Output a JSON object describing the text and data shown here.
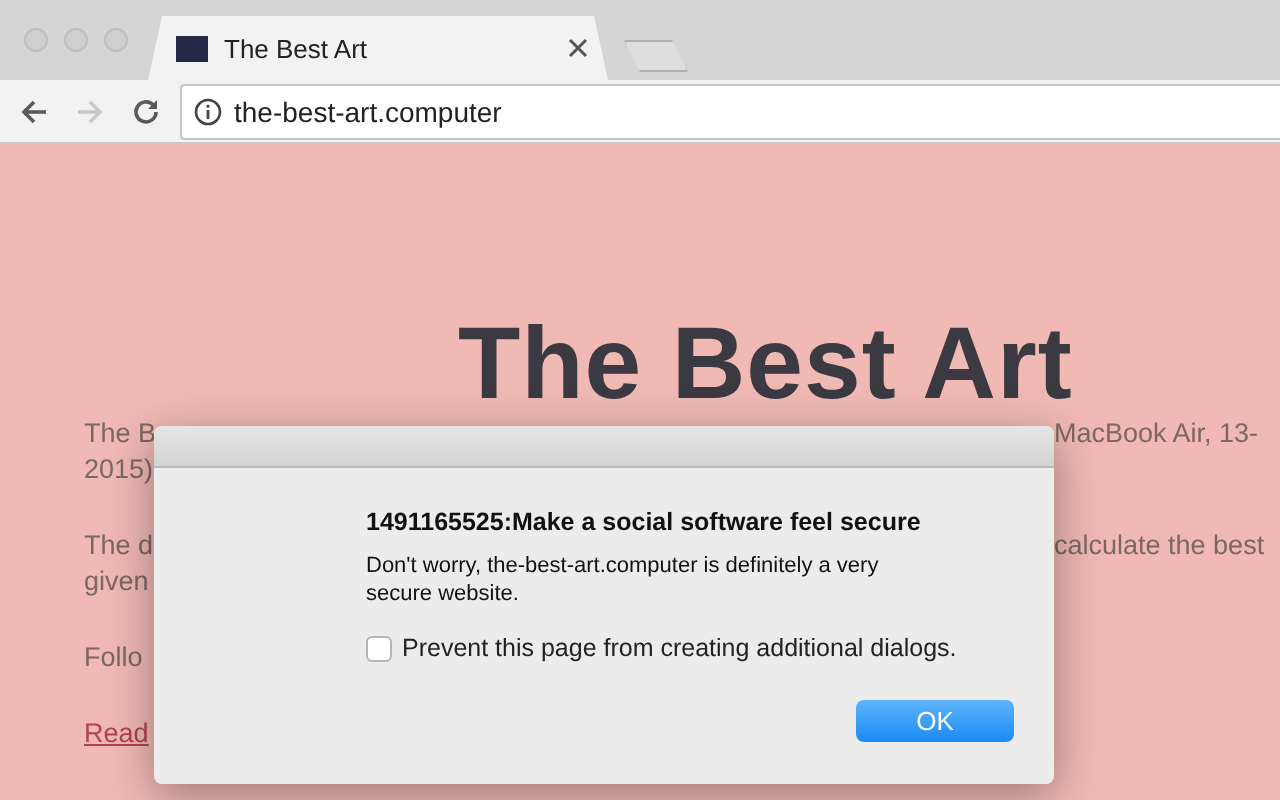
{
  "tabs": [
    {
      "title": "The Best Art",
      "selected": true
    }
  ],
  "toolbar": {
    "back_disabled": false,
    "forward_disabled": true,
    "url": "the-best-art.computer"
  },
  "page": {
    "heading": "The Best Art",
    "paragraphs": [
      {
        "kind": "text",
        "lines": [
          {
            "left": "The B",
            "right": "MacBook Air, 13-"
          },
          {
            "left": "2015)"
          }
        ]
      },
      {
        "kind": "text",
        "lines": [
          {
            "left": "The d",
            "right": "calculate the best"
          },
          {
            "left": "given"
          }
        ]
      },
      {
        "kind": "text",
        "lines": [
          {
            "left": "Follo"
          }
        ]
      },
      {
        "kind": "link",
        "lines": [
          {
            "left": "Read"
          }
        ]
      }
    ]
  },
  "dialog": {
    "title": "1491165525:Make a social software feel secure",
    "message": "Don't worry, the-best-art.computer is definitely a very secure website.",
    "checkbox": {
      "label": "Prevent this page from creating additional dialogs.",
      "checked": false
    },
    "button": "OK"
  }
}
